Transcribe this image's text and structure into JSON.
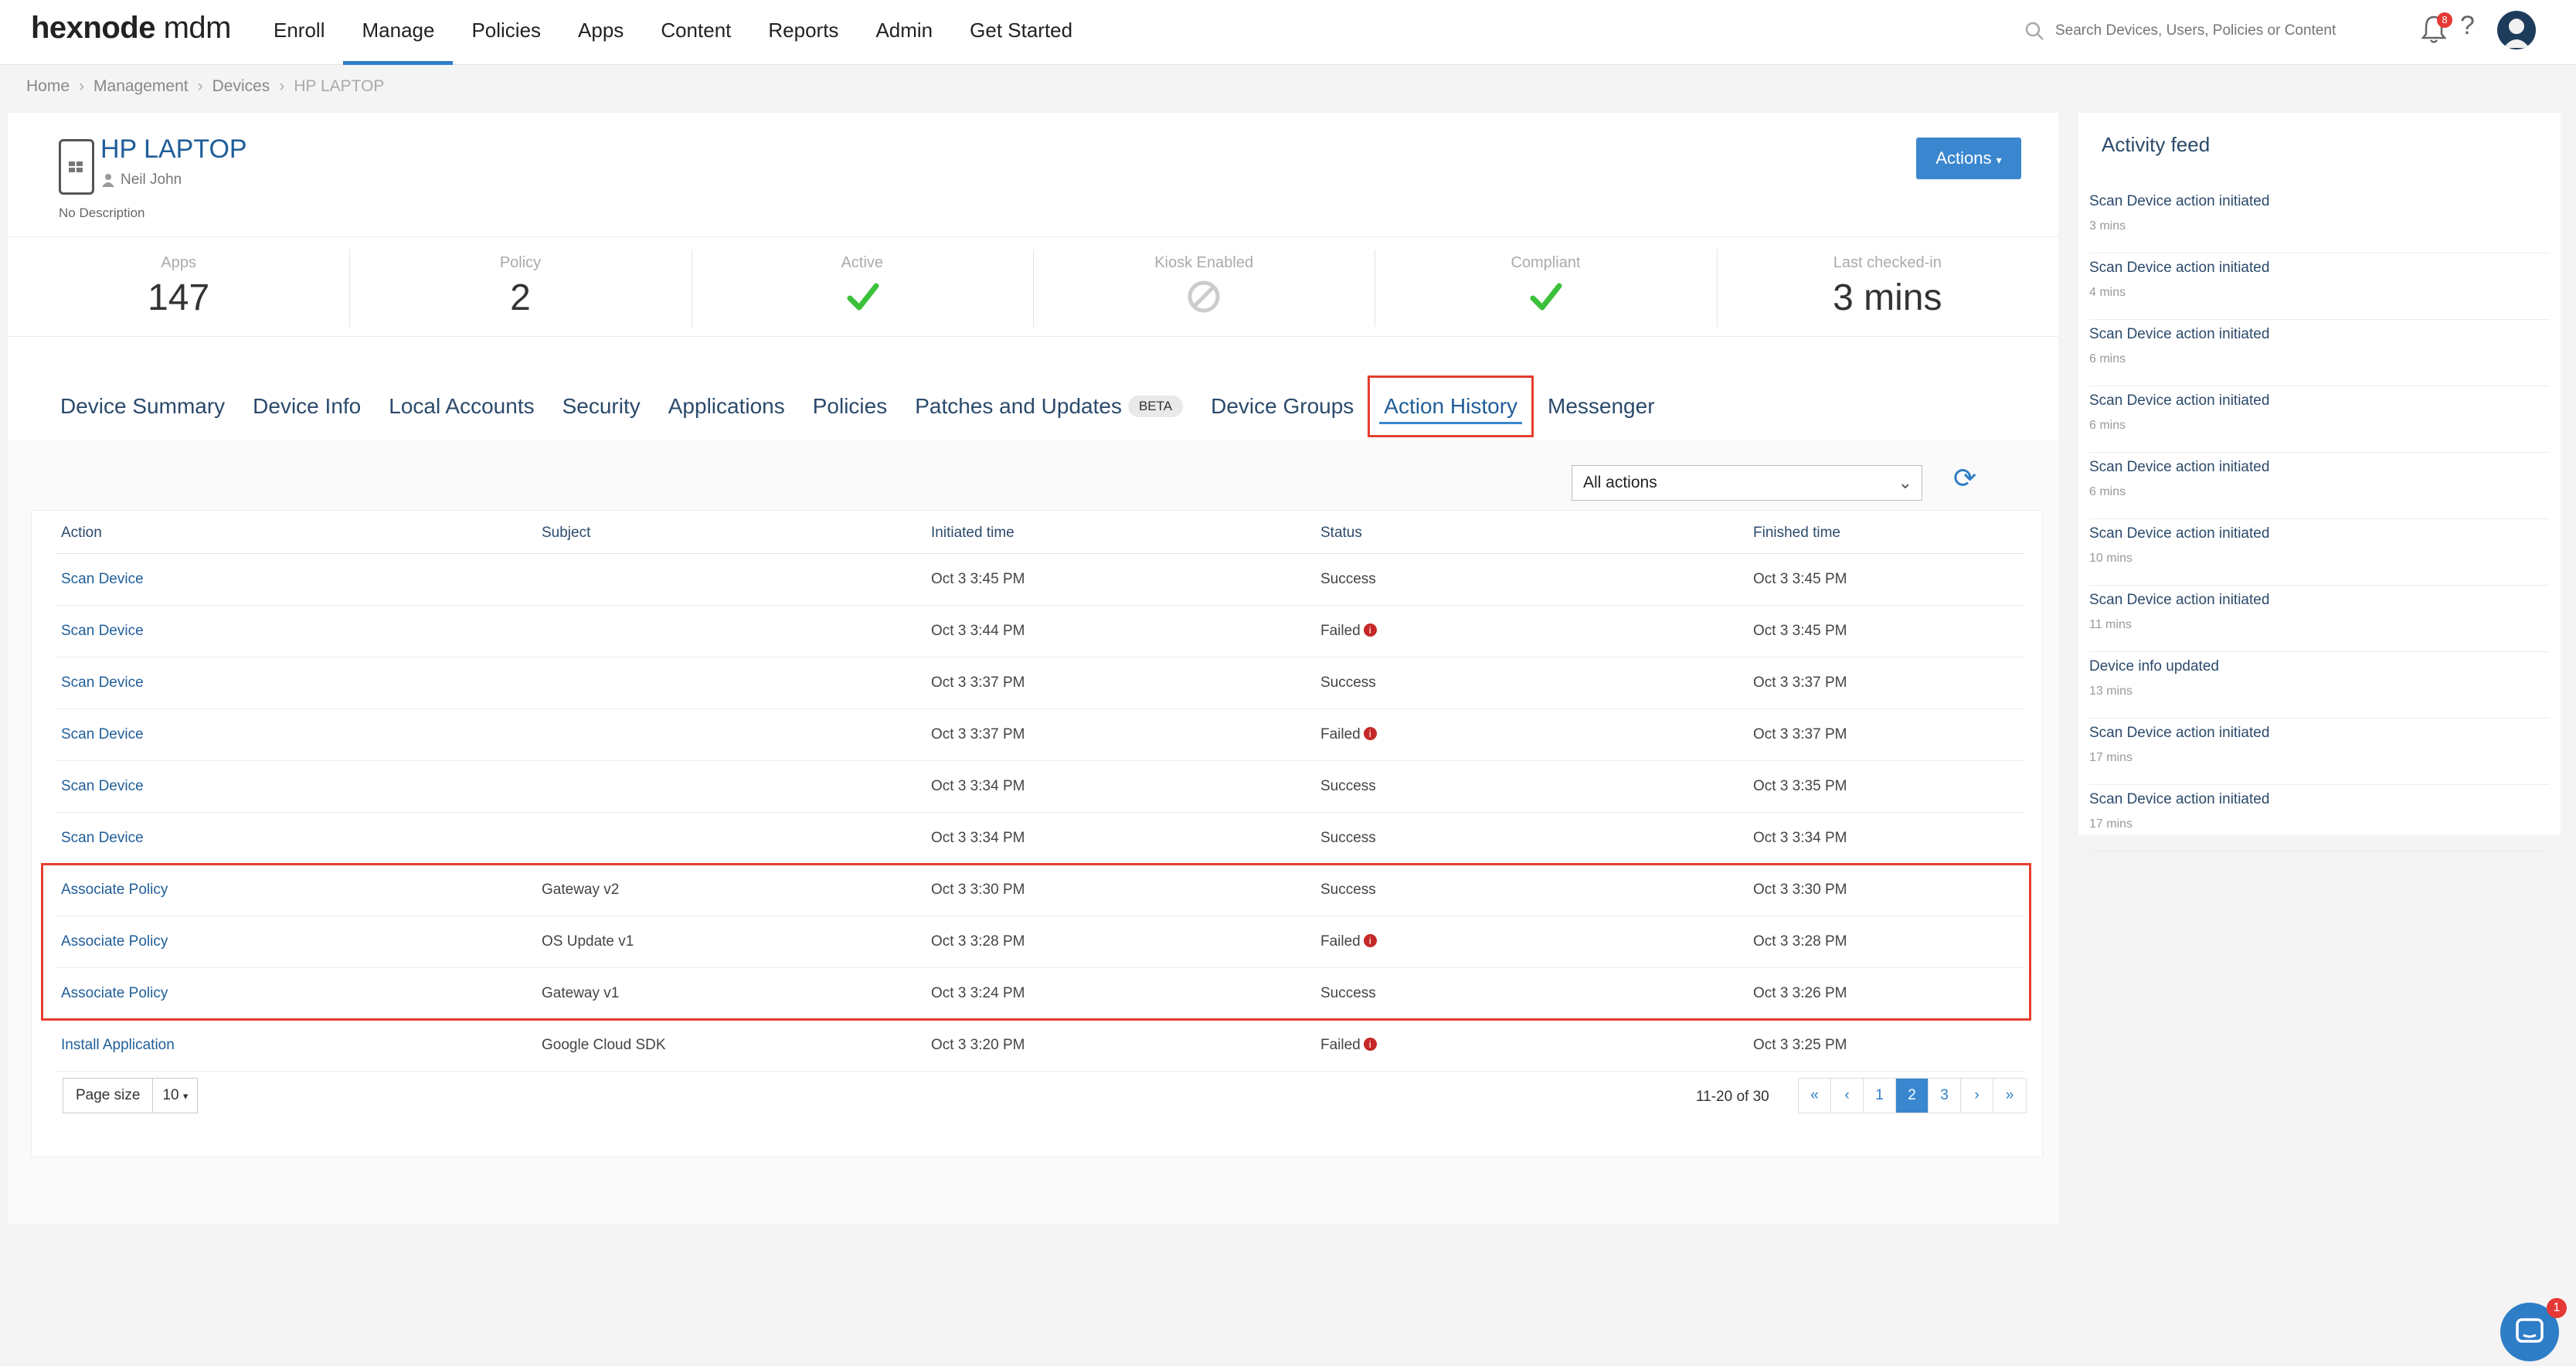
{
  "brand": {
    "logo_main": "hexnode",
    "logo_suffix": " mdm"
  },
  "nav": {
    "items": [
      "Enroll",
      "Manage",
      "Policies",
      "Apps",
      "Content",
      "Reports",
      "Admin",
      "Get Started"
    ],
    "active": "Manage"
  },
  "search": {
    "placeholder": "Search Devices, Users, Policies or Content"
  },
  "notifications": {
    "count": "8"
  },
  "breadcrumb": [
    "Home",
    "Management",
    "Devices",
    "HP LAPTOP"
  ],
  "device": {
    "name": "HP LAPTOP",
    "user": "Neil John",
    "description": "No Description",
    "actions_label": "Actions"
  },
  "stats": [
    {
      "label": "Apps",
      "value": "147"
    },
    {
      "label": "Policy",
      "value": "2"
    },
    {
      "label": "Active",
      "icon": "check-icon"
    },
    {
      "label": "Kiosk Enabled",
      "icon": "disabled-icon"
    },
    {
      "label": "Compliant",
      "icon": "check-icon"
    },
    {
      "label": "Last checked-in",
      "value": "3 mins"
    }
  ],
  "tabs": [
    "Device Summary",
    "Device Info",
    "Local Accounts",
    "Security",
    "Applications",
    "Policies",
    "Patches and Updates",
    "Device Groups",
    "Action History",
    "Messenger"
  ],
  "beta_label": "BETA",
  "active_tab": "Action History",
  "filter": {
    "selected": "All actions"
  },
  "table": {
    "headers": [
      "Action",
      "Subject",
      "Initiated time",
      "Status",
      "Finished time"
    ],
    "rows": [
      {
        "action": "Scan Device",
        "subject": "",
        "initiated": "Oct 3 3:45 PM",
        "status": "Success",
        "finished": "Oct 3 3:45 PM"
      },
      {
        "action": "Scan Device",
        "subject": "",
        "initiated": "Oct 3 3:44 PM",
        "status": "Failed",
        "finished": "Oct 3 3:45 PM"
      },
      {
        "action": "Scan Device",
        "subject": "",
        "initiated": "Oct 3 3:37 PM",
        "status": "Success",
        "finished": "Oct 3 3:37 PM"
      },
      {
        "action": "Scan Device",
        "subject": "",
        "initiated": "Oct 3 3:37 PM",
        "status": "Failed",
        "finished": "Oct 3 3:37 PM"
      },
      {
        "action": "Scan Device",
        "subject": "",
        "initiated": "Oct 3 3:34 PM",
        "status": "Success",
        "finished": "Oct 3 3:35 PM"
      },
      {
        "action": "Scan Device",
        "subject": "",
        "initiated": "Oct 3 3:34 PM",
        "status": "Success",
        "finished": "Oct 3 3:34 PM"
      },
      {
        "action": "Associate Policy",
        "subject": "Gateway v2",
        "initiated": "Oct 3 3:30 PM",
        "status": "Success",
        "finished": "Oct 3 3:30 PM"
      },
      {
        "action": "Associate Policy",
        "subject": "OS Update v1",
        "initiated": "Oct 3 3:28 PM",
        "status": "Failed",
        "finished": "Oct 3 3:28 PM"
      },
      {
        "action": "Associate Policy",
        "subject": "Gateway v1",
        "initiated": "Oct 3 3:24 PM",
        "status": "Success",
        "finished": "Oct 3 3:26 PM"
      },
      {
        "action": "Install Application",
        "subject": "Google Cloud SDK",
        "initiated": "Oct 3 3:20 PM",
        "status": "Failed",
        "finished": "Oct 3 3:25 PM"
      }
    ]
  },
  "pagination": {
    "page_size_label": "Page size",
    "page_size": "10",
    "info": "11-20 of 30",
    "pages": [
      "«",
      "‹",
      "1",
      "2",
      "3",
      "›",
      "»"
    ],
    "active_page": "2"
  },
  "activity_feed": {
    "title": "Activity feed",
    "items": [
      {
        "text": "Scan Device action initiated",
        "time": "3 mins"
      },
      {
        "text": "Scan Device action initiated",
        "time": "4 mins"
      },
      {
        "text": "Scan Device action initiated",
        "time": "6 mins"
      },
      {
        "text": "Scan Device action initiated",
        "time": "6 mins"
      },
      {
        "text": "Scan Device action initiated",
        "time": "6 mins"
      },
      {
        "text": "Scan Device action initiated",
        "time": "10 mins"
      },
      {
        "text": "Scan Device action initiated",
        "time": "11 mins"
      },
      {
        "text": "Device info updated",
        "time": "13 mins"
      },
      {
        "text": "Scan Device action initiated",
        "time": "17 mins"
      },
      {
        "text": "Scan Device action initiated",
        "time": "17 mins"
      }
    ]
  },
  "chat": {
    "badge": "1"
  },
  "colors": {
    "accent": "#3a87cf",
    "highlight": "#e53e2e",
    "success": "#3cc13b",
    "failed": "#c62828"
  }
}
